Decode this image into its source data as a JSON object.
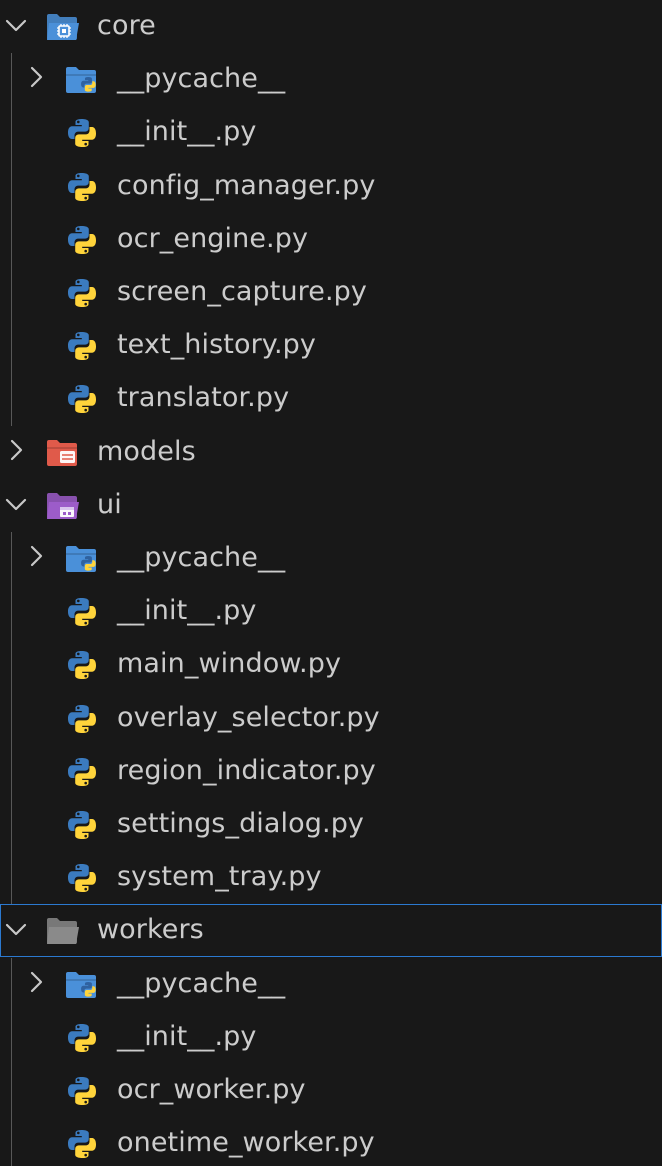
{
  "explorer": {
    "items": [
      {
        "label": "core",
        "type": "folder",
        "icon": "folder-core-open-icon",
        "expanded": true,
        "depth": 0
      },
      {
        "label": "__pycache__",
        "type": "folder",
        "icon": "folder-python-icon",
        "expanded": false,
        "depth": 1
      },
      {
        "label": "__init__.py",
        "type": "file",
        "icon": "python-file-icon",
        "depth": 1
      },
      {
        "label": "config_manager.py",
        "type": "file",
        "icon": "python-file-icon",
        "depth": 1
      },
      {
        "label": "ocr_engine.py",
        "type": "file",
        "icon": "python-file-icon",
        "depth": 1
      },
      {
        "label": "screen_capture.py",
        "type": "file",
        "icon": "python-file-icon",
        "depth": 1
      },
      {
        "label": "text_history.py",
        "type": "file",
        "icon": "python-file-icon",
        "depth": 1
      },
      {
        "label": "translator.py",
        "type": "file",
        "icon": "python-file-icon",
        "depth": 1
      },
      {
        "label": "models",
        "type": "folder",
        "icon": "folder-models-icon",
        "expanded": false,
        "depth": 0
      },
      {
        "label": "ui",
        "type": "folder",
        "icon": "folder-ui-open-icon",
        "expanded": true,
        "depth": 0
      },
      {
        "label": "__pycache__",
        "type": "folder",
        "icon": "folder-python-icon",
        "expanded": false,
        "depth": 1
      },
      {
        "label": "__init__.py",
        "type": "file",
        "icon": "python-file-icon",
        "depth": 1
      },
      {
        "label": "main_window.py",
        "type": "file",
        "icon": "python-file-icon",
        "depth": 1
      },
      {
        "label": "overlay_selector.py",
        "type": "file",
        "icon": "python-file-icon",
        "depth": 1
      },
      {
        "label": "region_indicator.py",
        "type": "file",
        "icon": "python-file-icon",
        "depth": 1
      },
      {
        "label": "settings_dialog.py",
        "type": "file",
        "icon": "python-file-icon",
        "depth": 1
      },
      {
        "label": "system_tray.py",
        "type": "file",
        "icon": "python-file-icon",
        "depth": 1
      },
      {
        "label": "workers",
        "type": "folder",
        "icon": "folder-open-icon",
        "expanded": true,
        "depth": 0,
        "selected": true
      },
      {
        "label": "__pycache__",
        "type": "folder",
        "icon": "folder-python-icon",
        "expanded": false,
        "depth": 1
      },
      {
        "label": "__init__.py",
        "type": "file",
        "icon": "python-file-icon",
        "depth": 1
      },
      {
        "label": "ocr_worker.py",
        "type": "file",
        "icon": "python-file-icon",
        "depth": 1
      },
      {
        "label": "onetime_worker.py",
        "type": "file",
        "icon": "python-file-icon",
        "depth": 1
      }
    ]
  },
  "colors": {
    "background": "#181818",
    "text": "#cccccc",
    "selection_outline": "#2b79d0",
    "indent_guide": "#585858",
    "python_blue": "#3b7bbf",
    "python_yellow": "#ffd43b",
    "folder_core": "#4a90d9",
    "folder_models": "#e05a4a",
    "folder_ui": "#9c5cc9",
    "folder_generic": "#8a8a8a"
  }
}
